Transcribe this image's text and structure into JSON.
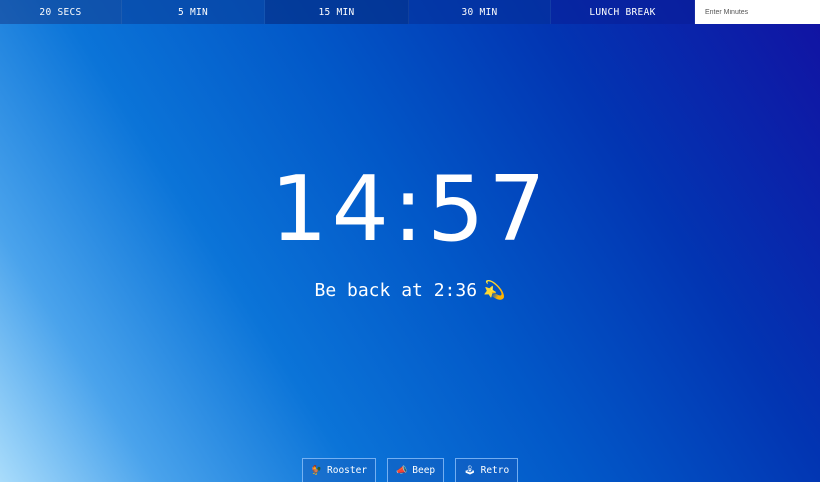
{
  "presets": [
    {
      "label": "20 SECS"
    },
    {
      "label": "5 MIN"
    },
    {
      "label": "15 MIN"
    },
    {
      "label": "30 MIN"
    },
    {
      "label": "LUNCH BREAK"
    }
  ],
  "minutes_input": {
    "placeholder": "Enter Minutes",
    "value": ""
  },
  "timer": {
    "display": "14:57"
  },
  "message": {
    "text": "Be back at 2:36",
    "emoji": "💫"
  },
  "sounds": [
    {
      "label": "Rooster",
      "icon": "🐓",
      "icon_name": "rooster-icon"
    },
    {
      "label": "Beep",
      "icon": "📣",
      "icon_name": "beep-icon"
    },
    {
      "label": "Retro",
      "icon": "🕹",
      "icon_name": "retro-icon"
    }
  ],
  "colors": {
    "background_start": "#a9dcfb",
    "background_mid": "#0b74d8",
    "background_end": "#1212a2",
    "text": "#ffffff"
  }
}
